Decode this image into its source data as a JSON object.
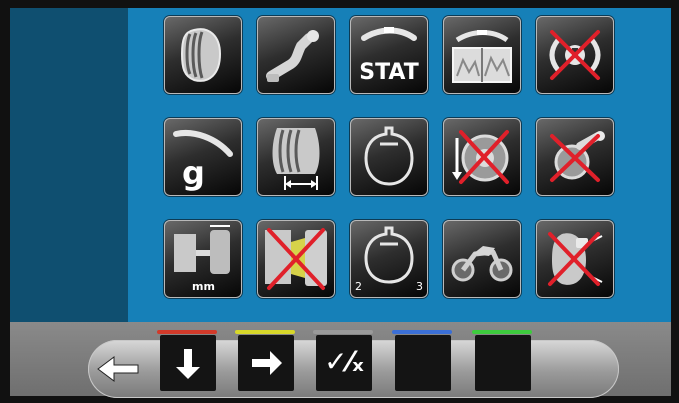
{
  "colors": {
    "main_bg": "#1680b8",
    "sidebar_bg": "#0f4f70",
    "bottom_bg": "#7d7d7d",
    "strip_red": "#d23a2a",
    "strip_yellow": "#d7d72a",
    "strip_gray": "#9a9a9a",
    "strip_blue": "#3b6fd6",
    "strip_green": "#3ecb3e"
  },
  "grid": {
    "row1": [
      {
        "icon": "tire-icon"
      },
      {
        "icon": "measuring-arm-icon"
      },
      {
        "icon": "stat-balancing-icon",
        "text": "STAT"
      },
      {
        "icon": "weight-position-display-icon"
      },
      {
        "icon": "sound-disabled-icon"
      }
    ],
    "row2": [
      {
        "icon": "weight-grams-icon",
        "text": "g"
      },
      {
        "icon": "tire-width-icon"
      },
      {
        "icon": "savings-counter-icon"
      },
      {
        "icon": "wheel-lowering-disabled-icon"
      },
      {
        "icon": "wheel-clamp-disabled-icon"
      }
    ],
    "row3": [
      {
        "icon": "unit-mm-icon",
        "text": "mm"
      },
      {
        "icon": "laser-disabled-icon"
      },
      {
        "icon": "counter-2-3-icon",
        "left": "2",
        "right": "3"
      },
      {
        "icon": "motorcycle-icon"
      },
      {
        "icon": "tire-lock-disabled-icon"
      }
    ]
  },
  "toolbar": {
    "keys": [
      {
        "icon": "arrow-left-icon"
      },
      {
        "icon": "arrow-down-icon"
      },
      {
        "icon": "arrow-right-icon"
      },
      {
        "icon": "check-x-toggle-icon",
        "text": "✓⁄ₓ"
      },
      {
        "icon": "blank-key-icon"
      },
      {
        "icon": "blank-key-icon"
      }
    ],
    "strips": [
      "red",
      "yellow",
      "gray",
      "blue",
      "green"
    ]
  }
}
